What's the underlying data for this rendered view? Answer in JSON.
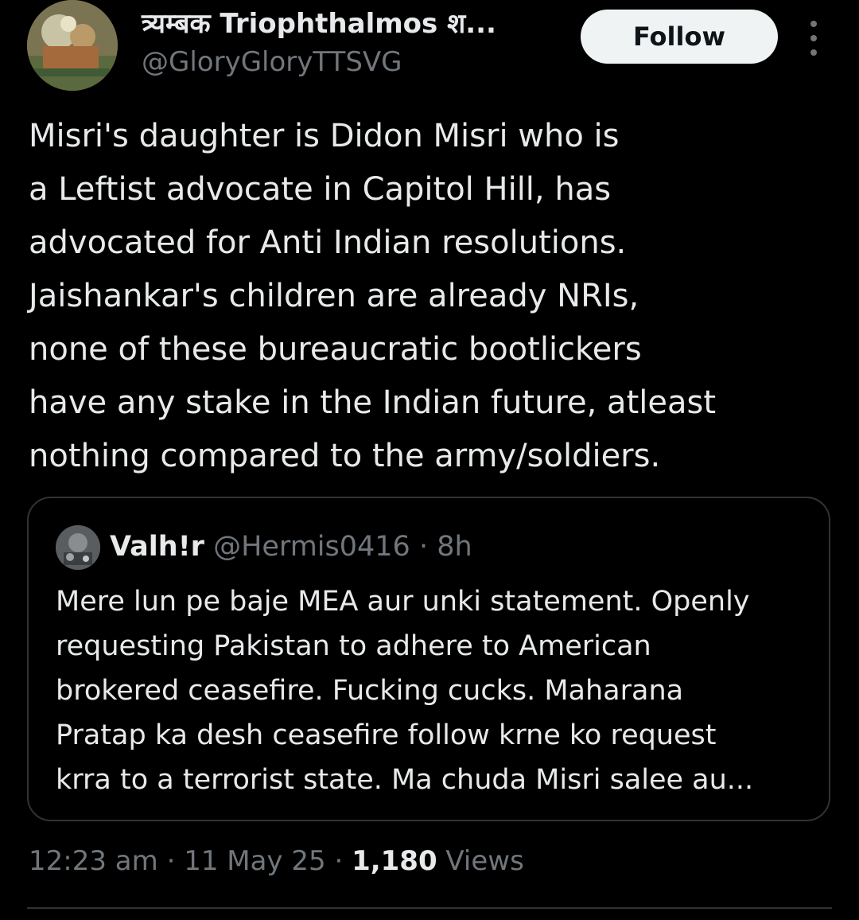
{
  "author": {
    "display_name": "त्र्यम्बक Triophthalmos श...",
    "handle": "@GloryGloryTTSVG"
  },
  "follow_button": {
    "label": "Follow"
  },
  "more_icon": "more-vertical-icon",
  "tweet": {
    "lines": [
      "Misri's daughter is Didon Misri who is",
      "a Leftist advocate in Capitol Hill, has",
      "advocated for Anti Indian resolutions.",
      "Jaishankar's children are already NRIs,",
      "none of these bureaucratic bootlickers",
      "have any stake in the Indian future, atleast",
      "nothing compared to the army/soldiers."
    ]
  },
  "quote": {
    "name": "Valh!r",
    "handle": "@Hermis0416",
    "separator": "·",
    "time": "8h",
    "lines": [
      "Mere lun pe baje MEA aur unki statement. Openly",
      "requesting Pakistan to adhere to American",
      "brokered ceasefire. Fucking cucks. Maharana",
      "Pratap ka desh ceasefire follow krne ko request",
      "krra to a terrorist state. Ma chuda Misri salee au..."
    ]
  },
  "meta": {
    "time": "12:23 am",
    "sep1": "·",
    "date": "11 May 25",
    "sep2": "·",
    "views_count": "1,180",
    "views_label": "Views"
  },
  "colors": {
    "background": "#000000",
    "text": "#e7e9ea",
    "secondary": "#71767b",
    "border": "#2f3336",
    "follow_bg": "#eff3f4"
  }
}
